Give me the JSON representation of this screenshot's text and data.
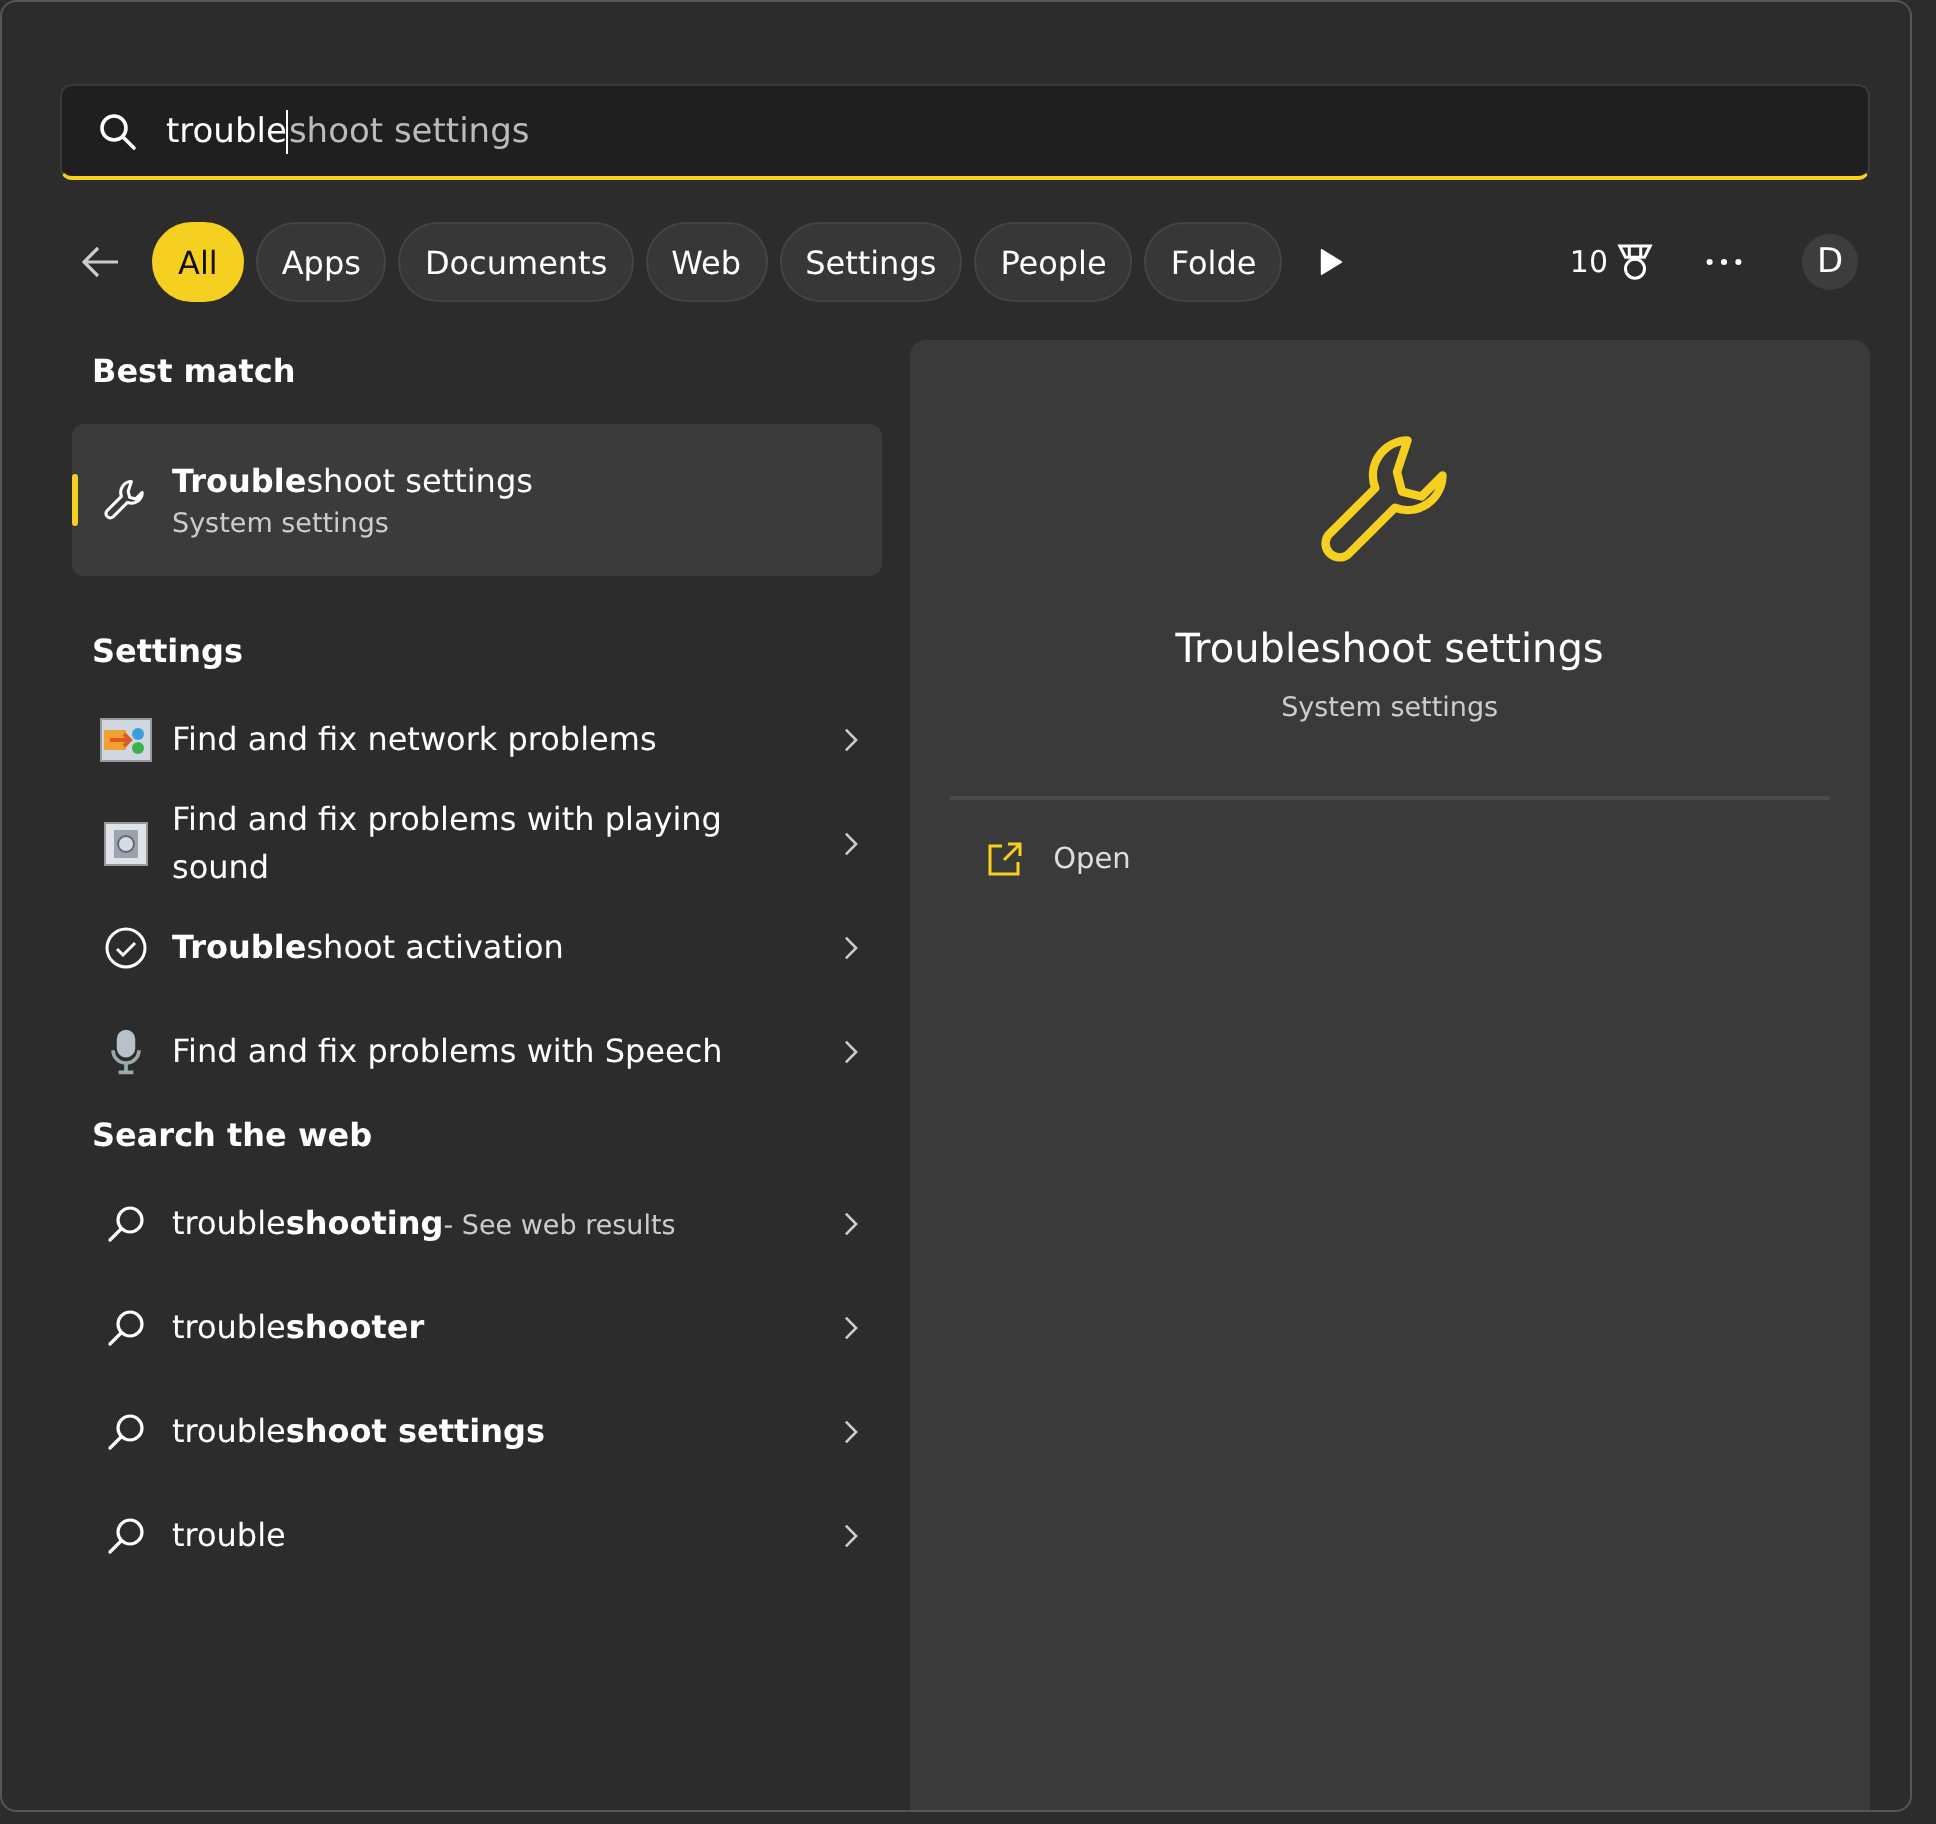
{
  "search": {
    "typed": "trouble",
    "completion": "shoot settings"
  },
  "filters": [
    {
      "label": "All",
      "selected": true
    },
    {
      "label": "Apps",
      "selected": false
    },
    {
      "label": "Documents",
      "selected": false
    },
    {
      "label": "Web",
      "selected": false
    },
    {
      "label": "Settings",
      "selected": false
    },
    {
      "label": "People",
      "selected": false
    },
    {
      "label": "Folde",
      "selected": false
    }
  ],
  "rewards": {
    "count": "10"
  },
  "account": {
    "initial": "D"
  },
  "best_match": {
    "heading": "Best match",
    "title": "**Trouble**shoot settings",
    "subtitle": "System settings",
    "selected": true
  },
  "settings": {
    "heading": "Settings",
    "items": [
      {
        "kind": "network",
        "label": "Find and fix network problems"
      },
      {
        "kind": "sound",
        "label": "Find and fix problems with playing sound"
      },
      {
        "kind": "check",
        "label": "**Trouble**shoot activation"
      },
      {
        "kind": "mic",
        "label": "Find and fix problems with Speech"
      }
    ]
  },
  "web": {
    "heading": "Search the web",
    "items": [
      {
        "label": "trouble**shooting**",
        "hint": "- See web results"
      },
      {
        "label": "trouble**shooter**"
      },
      {
        "label": "trouble**shoot settings**"
      },
      {
        "label": "trouble"
      }
    ]
  },
  "preview": {
    "title": "Troubleshoot settings",
    "subtitle": "System settings",
    "actions": [
      {
        "label": "Open"
      }
    ]
  }
}
